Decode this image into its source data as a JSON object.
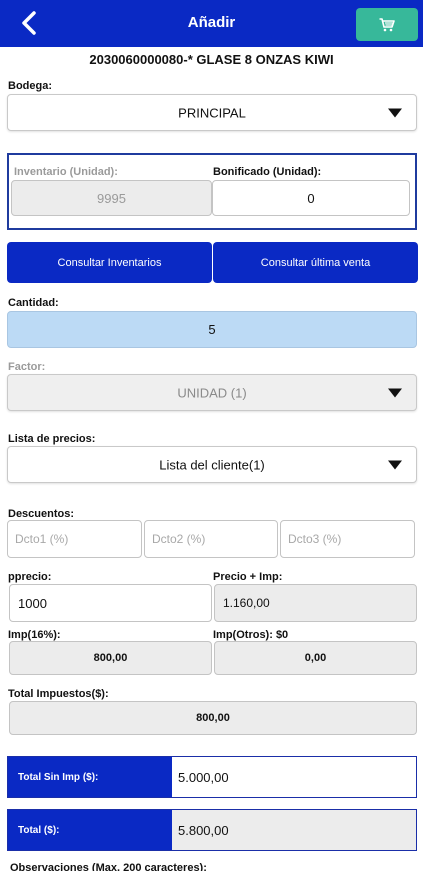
{
  "header": {
    "title": "Añadir",
    "back_icon": "back-arrow-icon",
    "cart_icon": "cart-icon",
    "cart_button_color": "#37b89a",
    "bar_color": "#0a29c4"
  },
  "product": {
    "name": "2030060000080-* GLASE 8 ONZAS KIWI"
  },
  "bodega": {
    "label": "Bodega:",
    "value": "PRINCIPAL"
  },
  "inventario": {
    "label": "Inventario (Unidad):",
    "value": "9995"
  },
  "bonificado": {
    "label": "Bonificado (Unidad):",
    "value": "0"
  },
  "buttons": {
    "consultar_inventarios": "Consultar Inventarios",
    "consultar_ultima_venta": "Consultar última venta"
  },
  "cantidad": {
    "label": "Cantidad:",
    "value": "5"
  },
  "factor": {
    "label": "Factor:",
    "value": "UNIDAD (1)"
  },
  "lista_precios": {
    "label": "Lista de precios:",
    "value": "Lista del cliente(1)"
  },
  "descuentos": {
    "label": "Descuentos:",
    "dcto1_placeholder": "Dcto1 (%)",
    "dcto2_placeholder": "Dcto2 (%)",
    "dcto3_placeholder": "Dcto3 (%)"
  },
  "pprecio": {
    "label": "pprecio:",
    "value": "1000"
  },
  "precio_imp": {
    "label": "Precio + Imp:",
    "value": "1.160,00"
  },
  "imp16": {
    "label": "Imp(16%):",
    "value": "800,00"
  },
  "imp_otros": {
    "label": "Imp(Otros): $0",
    "value": "0,00"
  },
  "total_impuestos": {
    "label": "Total Impuestos($):",
    "value": "800,00"
  },
  "total_sin_imp": {
    "label": "Total Sin Imp ($):",
    "value": "5.000,00"
  },
  "total": {
    "label": "Total ($):",
    "value": "5.800,00"
  },
  "observaciones": {
    "label": "Observaciones (Max. 200 caracteres):"
  }
}
